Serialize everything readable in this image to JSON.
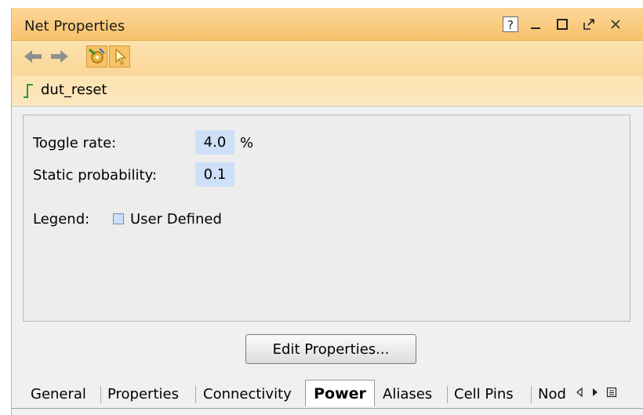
{
  "window": {
    "title": "Net Properties",
    "controls": {
      "help": "?",
      "minimize": "_",
      "maximize": "☐",
      "float": "↗",
      "close": "×"
    }
  },
  "toolbar": {
    "back_icon": "arrow-left",
    "forward_icon": "arrow-right",
    "tools": [
      "auto-update-icon",
      "select-pointer-icon"
    ]
  },
  "net": {
    "name": "dut_reset",
    "icon": "signal-step-icon"
  },
  "power": {
    "toggle_rate_label": "Toggle rate:",
    "toggle_rate_value": "4.0",
    "toggle_rate_unit": "%",
    "static_prob_label": "Static probability:",
    "static_prob_value": "0.1",
    "legend_label": "Legend:",
    "legend_item": "User Defined"
  },
  "actions": {
    "edit_properties": "Edit Properties..."
  },
  "tabs": {
    "items": [
      "General",
      "Properties",
      "Connectivity",
      "Power",
      "Aliases",
      "Cell Pins",
      "Nod"
    ],
    "active": "Power"
  },
  "colors": {
    "title_bar": "#f7c26a",
    "user_defined_fill": "#cde0f7",
    "signal_green": "#2a9a2a"
  }
}
